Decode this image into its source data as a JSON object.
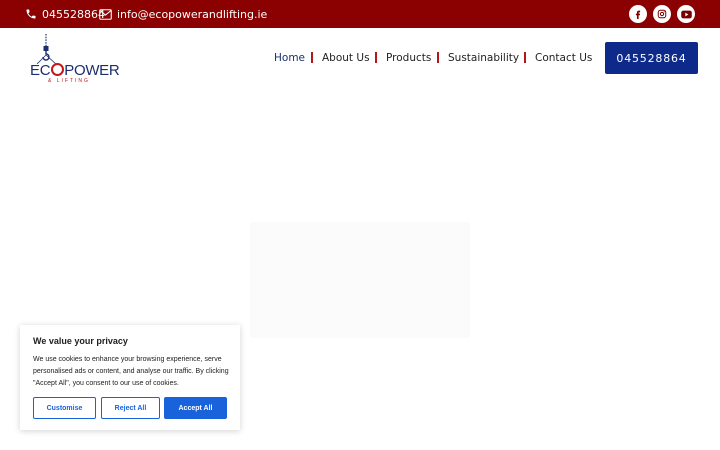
{
  "topbar": {
    "phone": "045528864",
    "email": "info@ecopowerandlifting.ie",
    "social": [
      "facebook-icon",
      "instagram-icon",
      "youtube-icon"
    ],
    "background": "#8b0000"
  },
  "logo": {
    "word_start": "EC",
    "word_end": "POWER",
    "sub": "& LIFTING"
  },
  "nav": {
    "items": [
      {
        "label": "Home",
        "active": true
      },
      {
        "label": "About Us"
      },
      {
        "label": "Products"
      },
      {
        "label": "Sustainability"
      },
      {
        "label": "Contact Us"
      }
    ],
    "cta_label": "045528864",
    "cta_color": "#0d2a8a",
    "separator_color": "#b01818"
  },
  "cookie": {
    "title": "We value your privacy",
    "text": "We use cookies to enhance your browsing experience, serve personalised ads or content, and analyse our traffic. By clicking \"Accept All\", you consent to our use of cookies.",
    "customise": "Customise",
    "reject": "Reject All",
    "accept": "Accept All",
    "accent": "#1863dc"
  }
}
